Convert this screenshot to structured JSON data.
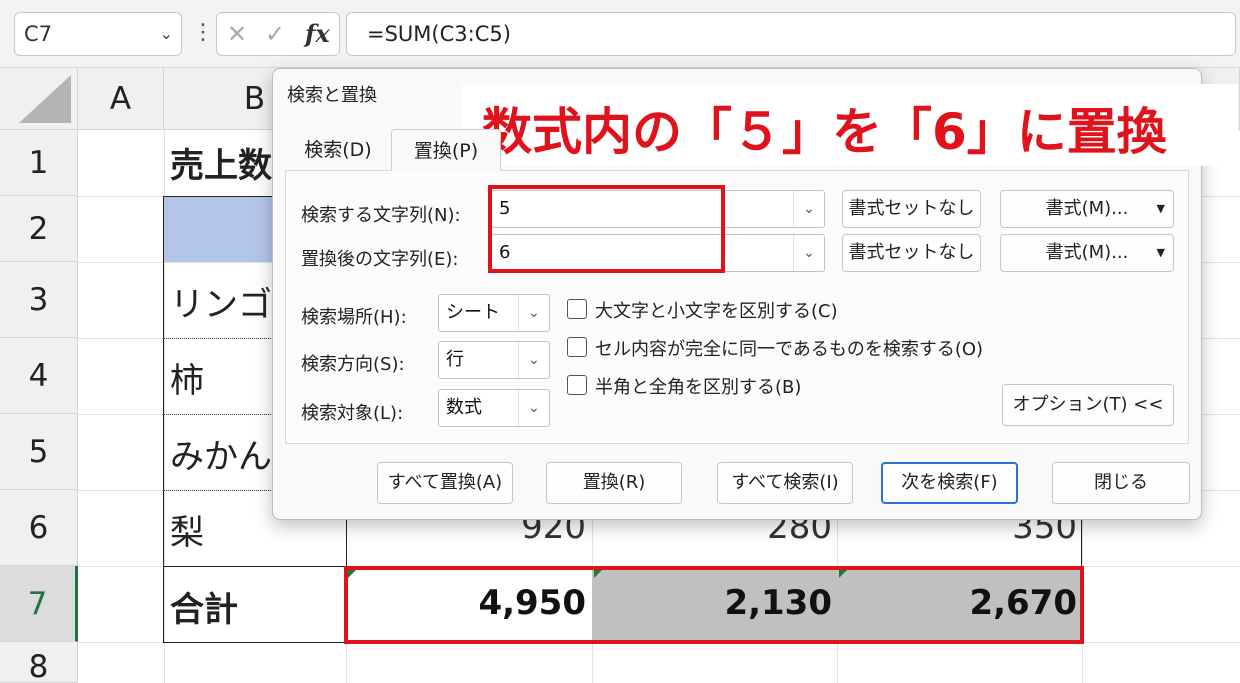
{
  "formula_bar": {
    "name_box": "C7",
    "cancel_icon": "✕",
    "enter_icon": "✓",
    "fx_label": "fx",
    "formula": "=SUM(C3:C5)"
  },
  "columns": [
    "A",
    "B"
  ],
  "rows": [
    "1",
    "2",
    "3",
    "4",
    "5",
    "6",
    "7",
    "8"
  ],
  "cells": {
    "b1": "売上数",
    "b3": "リンゴ",
    "b4": "柿",
    "b5": "みかん",
    "b6": "梨",
    "b7": "合計",
    "c6": "920",
    "d6": "280",
    "e6": "350",
    "c7": "4,950",
    "d7": "2,130",
    "e7": "2,670"
  },
  "dialog": {
    "title": "検索と置換",
    "tabs": {
      "find": "検索(D)",
      "replace": "置換(P)"
    },
    "find_label": "検索する文字列(N):",
    "replace_label": "置換後の文字列(E):",
    "find_value": "5",
    "replace_value": "6",
    "no_format_label": "書式セットなし",
    "format_button": "書式(M)...",
    "within_label": "検索場所(H):",
    "within_value": "シート",
    "search_label": "検索方向(S):",
    "search_value": "行",
    "look_in_label": "検索対象(L):",
    "look_in_value": "数式",
    "match_case": "大文字と小文字を区別する(C)",
    "match_entire": "セル内容が完全に同一であるものを検索する(O)",
    "match_byte": "半角と全角を区別する(B)",
    "options_button": "オプション(T) <<",
    "replace_all": "すべて置換(A)",
    "replace": "置換(R)",
    "find_all": "すべて検索(I)",
    "find_next": "次を検索(F)",
    "close": "閉じる"
  },
  "annotation": "数式内の「５」を「6」に置換",
  "colors": {
    "accent_red": "#e0121b",
    "header_fill": "#b4c6e7",
    "selected_fill": "#c0c0c0",
    "primary_blue": "#2f6fd6"
  }
}
